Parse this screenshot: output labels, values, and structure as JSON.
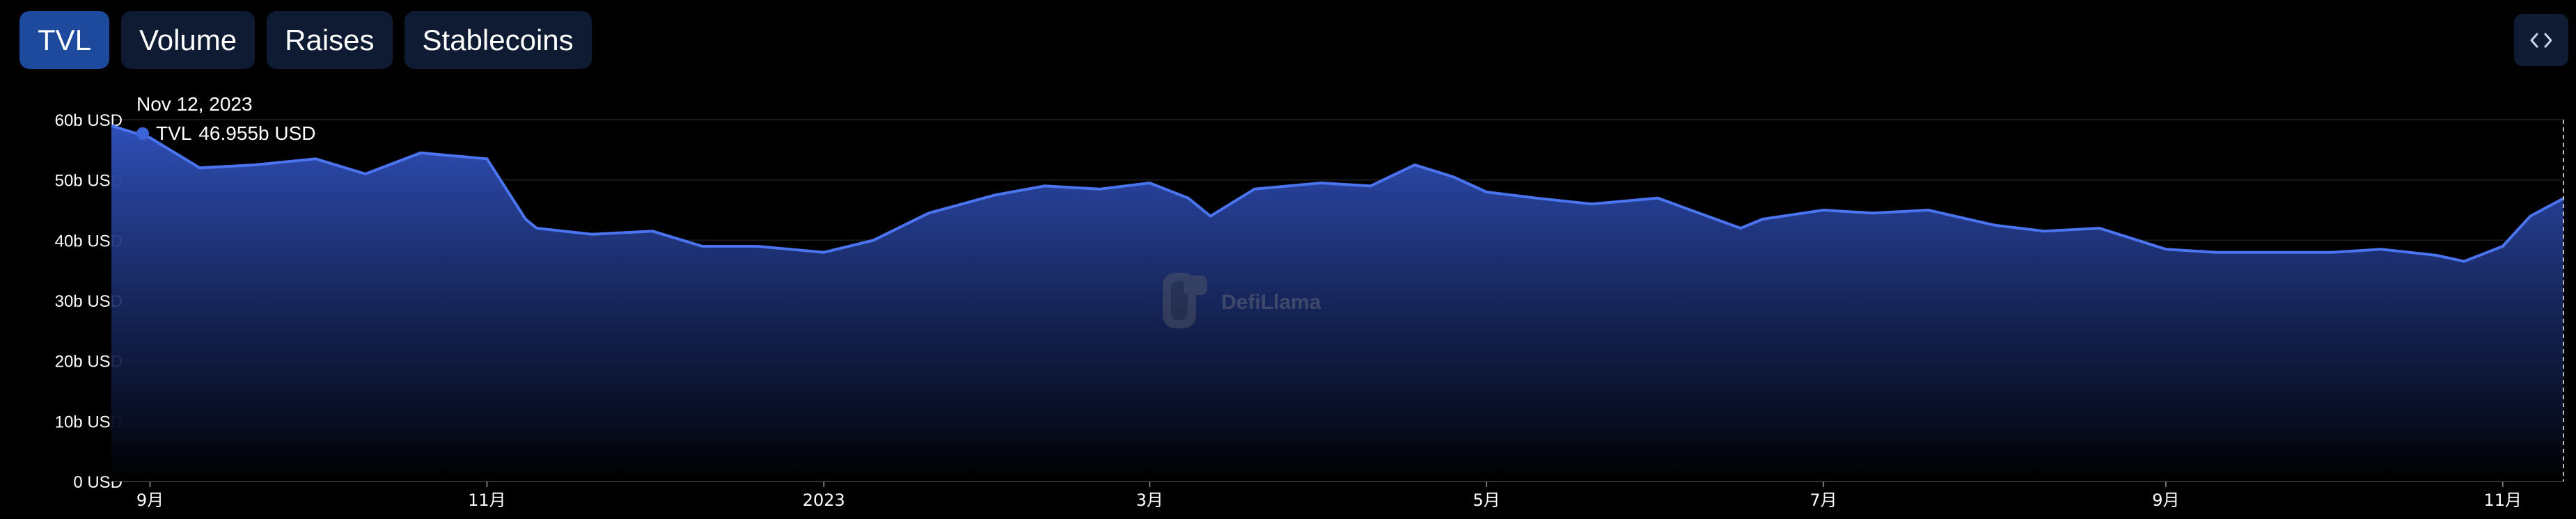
{
  "tabs": [
    {
      "label": "TVL",
      "active": true
    },
    {
      "label": "Volume",
      "active": false
    },
    {
      "label": "Raises",
      "active": false
    },
    {
      "label": "Stablecoins",
      "active": false
    }
  ],
  "embed_button": {
    "icon": "code-brackets-icon"
  },
  "watermark": {
    "text": "DefiLlama",
    "icon": "llama-logo-icon"
  },
  "tooltip": {
    "date": "Nov 12, 2023",
    "series_label": "TVL",
    "value": "46.955b USD"
  },
  "colors": {
    "background": "#000000",
    "line": "#4a74f0",
    "fill_top": "#2f4fb8",
    "tab_active": "#1d4a9c",
    "tab_inactive": "#0f1a33",
    "grid": "#1a1a1a",
    "axis_text": "#ffffff"
  },
  "chart_data": {
    "type": "area",
    "series": [
      {
        "name": "TVL",
        "unit": "b USD",
        "x": [
          "2022-08-25",
          "2022-09-01",
          "2022-09-10",
          "2022-09-20",
          "2022-10-01",
          "2022-10-10",
          "2022-10-20",
          "2022-11-01",
          "2022-11-08",
          "2022-11-10",
          "2022-11-20",
          "2022-12-01",
          "2022-12-10",
          "2022-12-20",
          "2023-01-01",
          "2023-01-10",
          "2023-01-20",
          "2023-02-01",
          "2023-02-10",
          "2023-02-20",
          "2023-03-01",
          "2023-03-08",
          "2023-03-12",
          "2023-03-20",
          "2023-04-01",
          "2023-04-10",
          "2023-04-18",
          "2023-04-25",
          "2023-05-01",
          "2023-05-10",
          "2023-05-20",
          "2023-06-01",
          "2023-06-10",
          "2023-06-16",
          "2023-06-20",
          "2023-07-01",
          "2023-07-10",
          "2023-07-20",
          "2023-08-01",
          "2023-08-10",
          "2023-08-20",
          "2023-09-01",
          "2023-09-10",
          "2023-09-20",
          "2023-10-01",
          "2023-10-10",
          "2023-10-20",
          "2023-10-25",
          "2023-11-01",
          "2023-11-06",
          "2023-11-12"
        ],
        "values": [
          59.0,
          57.0,
          52.0,
          52.5,
          53.5,
          51.0,
          54.5,
          53.5,
          43.5,
          42.0,
          41.0,
          41.5,
          39.0,
          39.0,
          38.0,
          40.0,
          44.5,
          47.5,
          49.0,
          48.5,
          49.5,
          47.0,
          44.0,
          48.5,
          49.5,
          49.0,
          52.5,
          50.5,
          48.0,
          47.0,
          46.0,
          47.0,
          44.0,
          42.0,
          43.5,
          45.0,
          44.5,
          45.0,
          42.5,
          41.5,
          42.0,
          38.5,
          38.0,
          38.0,
          38.0,
          38.5,
          37.5,
          36.5,
          39.0,
          44.0,
          46.955
        ]
      }
    ],
    "title": "",
    "xlabel": "",
    "ylabel": "",
    "ylim": [
      0,
      60
    ],
    "yticks": [
      "0 USD",
      "10b USD",
      "20b USD",
      "30b USD",
      "40b USD",
      "50b USD",
      "60b USD"
    ],
    "xticks": [
      {
        "label": "9月",
        "date": "2022-09-01"
      },
      {
        "label": "11月",
        "date": "2022-11-01"
      },
      {
        "label": "2023",
        "date": "2023-01-01"
      },
      {
        "label": "3月",
        "date": "2023-03-01"
      },
      {
        "label": "5月",
        "date": "2023-05-01"
      },
      {
        "label": "7月",
        "date": "2023-07-01"
      },
      {
        "label": "9月",
        "date": "2023-09-01"
      },
      {
        "label": "11月",
        "date": "2023-11-01"
      }
    ],
    "x_range": [
      "2022-08-25",
      "2023-11-12"
    ],
    "grid": true,
    "legend": "none"
  }
}
